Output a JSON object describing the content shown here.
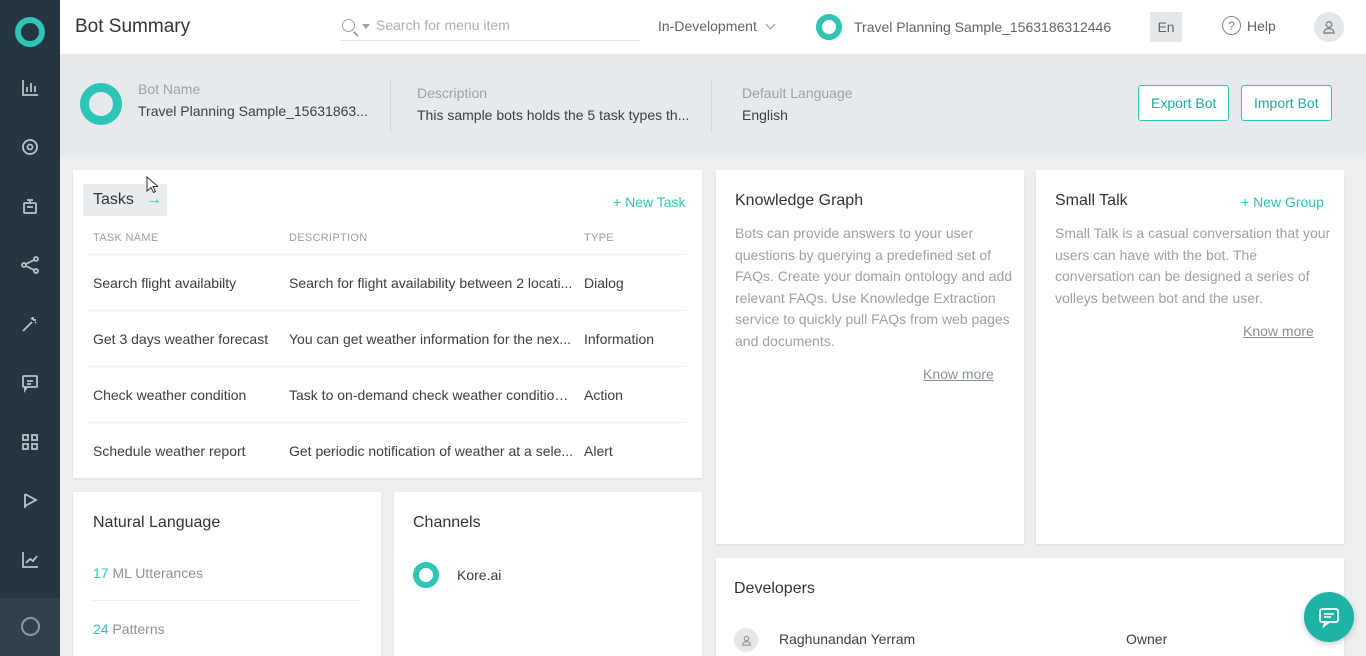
{
  "header": {
    "title": "Bot Summary",
    "search_placeholder": "Search for menu item",
    "environment": "In-Development",
    "bot_selector": "Travel Planning Sample_1563186312446",
    "language_button": "En",
    "help_label": "Help"
  },
  "bot_info": {
    "name_label": "Bot Name",
    "name_value": "Travel Planning Sample_15631863...",
    "description_label": "Description",
    "description_value": "This sample bots holds the 5 task types th...",
    "language_label": "Default Language",
    "language_value": "English",
    "export_label": "Export Bot",
    "import_label": "Import Bot"
  },
  "tasks": {
    "title": "Tasks",
    "new_label": "+ New Task",
    "columns": [
      "TASK NAME",
      "DESCRIPTION",
      "TYPE"
    ],
    "rows": [
      {
        "name": "Search flight availabilty",
        "description": "Search for flight availability between 2 locati...",
        "type": "Dialog"
      },
      {
        "name": "Get 3 days weather forecast",
        "description": "You can get weather information for the nex...",
        "type": "Information"
      },
      {
        "name": "Check weather condition",
        "description": "Task to on-demand check weather condition ...",
        "type": "Action"
      },
      {
        "name": "Schedule weather report",
        "description": "Get periodic notification of weather at a sele...",
        "type": "Alert"
      }
    ]
  },
  "knowledge_graph": {
    "title": "Knowledge Graph",
    "body": "Bots can provide answers to your user questions by querying a predefined set of FAQs. Create your domain ontology and add relevant FAQs. Use Knowledge Extraction service to quickly pull FAQs from web pages and documents.",
    "know_more": "Know more"
  },
  "small_talk": {
    "title": "Small Talk",
    "new_label": "+ New Group",
    "body": "Small Talk is a casual conversation that your users can have with the bot. The conversation can be designed a series of volleys between bot and the user.",
    "know_more": "Know more"
  },
  "natural_language": {
    "title": "Natural Language",
    "items": [
      {
        "count": "17",
        "label": " ML Utterances"
      },
      {
        "count": "24",
        "label": " Patterns"
      }
    ]
  },
  "channels": {
    "title": "Channels",
    "items": [
      {
        "name": "Kore.ai"
      }
    ]
  },
  "developers": {
    "title": "Developers",
    "items": [
      {
        "name": "Raghunandan Yerram",
        "role": "Owner"
      }
    ]
  },
  "colors": {
    "accent": "#2ec4b6",
    "rail": "#263640"
  },
  "icons": {
    "rail": [
      "chart-bars-icon",
      "chat-search-icon",
      "bot-icon",
      "flow-icon",
      "wand-icon",
      "message-icon",
      "grid-icon",
      "play-flag-icon",
      "line-chart-icon"
    ]
  }
}
